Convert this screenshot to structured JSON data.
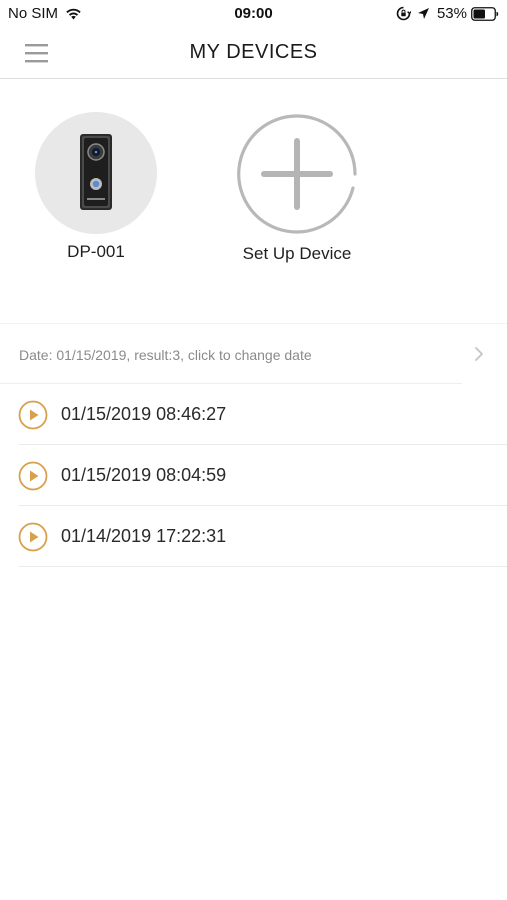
{
  "status_bar": {
    "carrier": "No SIM",
    "time": "09:00",
    "battery_percent": "53%",
    "icons": [
      "wifi-icon",
      "rotation-lock-icon",
      "location-icon",
      "battery-icon"
    ]
  },
  "nav": {
    "title": "MY DEVICES",
    "menu_icon": "hamburger-menu-icon"
  },
  "devices": [
    {
      "label": "DP-001",
      "icon": "doorbell-device-image"
    },
    {
      "label": "Set Up Device",
      "icon": "add-icon"
    }
  ],
  "date_row": {
    "text": "Date: 01/15/2019, result:3, click to change date",
    "icon": "chevron-right-icon"
  },
  "recordings": [
    {
      "timestamp": "01/15/2019 08:46:27"
    },
    {
      "timestamp": "01/15/2019 08:04:59"
    },
    {
      "timestamp": "01/14/2019 17:22:31"
    }
  ],
  "colors": {
    "accent": "#d9a04c",
    "divider": "#eaeaea",
    "muted_text": "#8a8a8a",
    "device_bg": "#e8e8e8",
    "add_icon": "#b5b5b5"
  }
}
